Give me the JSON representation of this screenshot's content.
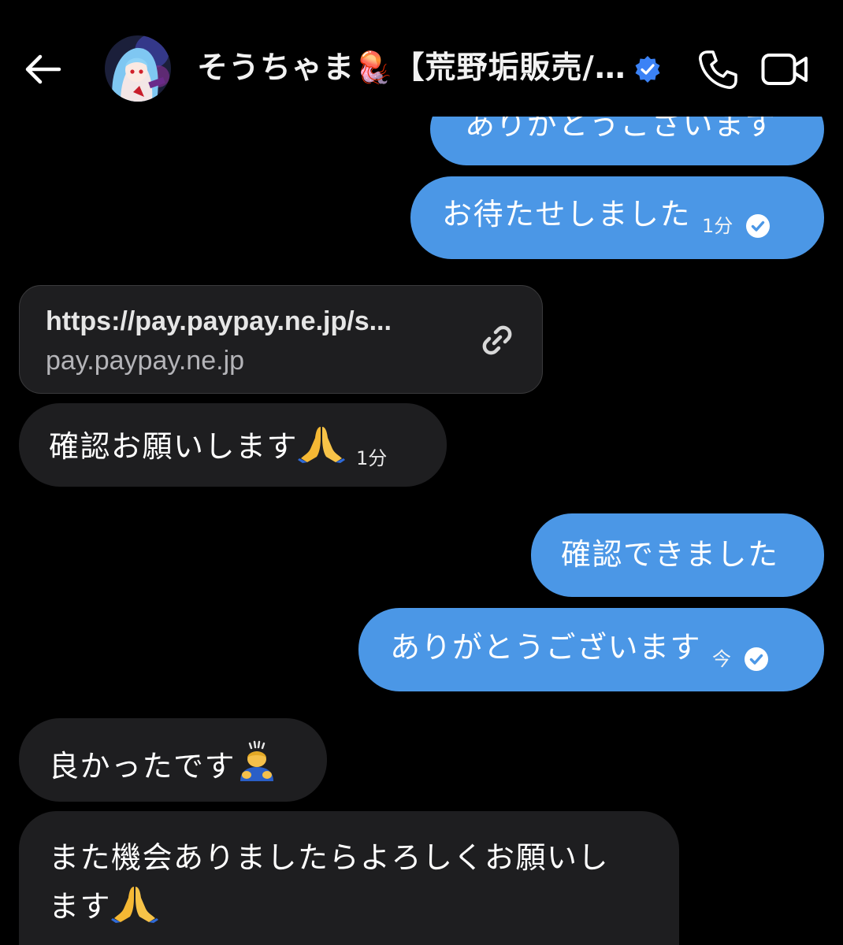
{
  "header": {
    "back_icon": "back-arrow-icon",
    "contact_name": "そうちゃま🪼【荒野垢販売/…",
    "verified_icon": "verified-badge-icon",
    "call_icon": "phone-icon",
    "video_icon": "video-camera-icon"
  },
  "colors": {
    "background": "#000000",
    "outgoing_bubble": "#4b97e6",
    "incoming_bubble": "#1e1e20",
    "verified": "#3b82f6"
  },
  "messages": [
    {
      "direction": "out",
      "text": "ありがとうございます",
      "time": "",
      "seen": false
    },
    {
      "direction": "out",
      "text": "お待たせしました",
      "time": "1分",
      "seen": true
    },
    {
      "direction": "in",
      "type": "link",
      "url": "https://pay.paypay.ne.jp/s...",
      "domain": "pay.paypay.ne.jp",
      "icon": "link-icon"
    },
    {
      "direction": "in",
      "text": "確認お願いします",
      "emoji": "folded-hands-emoji",
      "time": "1分"
    },
    {
      "direction": "out",
      "text": "確認できました",
      "time": "",
      "seen": false
    },
    {
      "direction": "out",
      "text": "ありがとうございます",
      "time": "今",
      "seen": true
    },
    {
      "direction": "in",
      "text": "良かったです",
      "emoji": "bowing-person-emoji",
      "time": ""
    },
    {
      "direction": "in",
      "text_line1": "また機会ありましたらよろしくお願いし",
      "text_line2": "ます",
      "emoji": "folded-hands-emoji",
      "time": ""
    }
  ]
}
